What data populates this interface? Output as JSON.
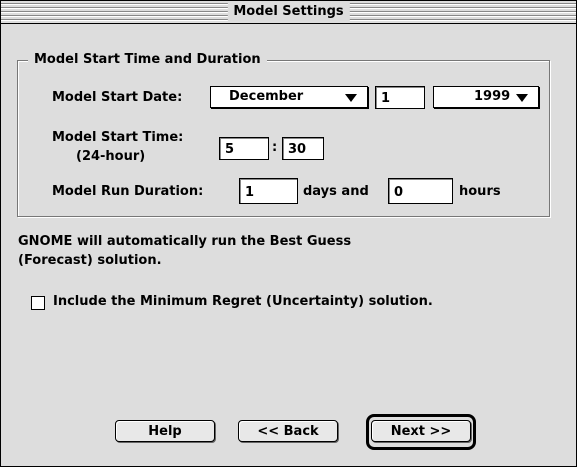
{
  "window": {
    "title": "Model Settings"
  },
  "group": {
    "legend": "Model Start Time and Duration",
    "start_date_label": "Model Start Date:",
    "month": "December",
    "day": "1",
    "year": "1999",
    "start_time_label_line1": "Model Start Time:",
    "start_time_label_line2": "(24-hour)",
    "hour": "5",
    "time_separator": ":",
    "minute": "30",
    "run_duration_label": "Model Run Duration:",
    "days": "1",
    "days_and_label": "days and",
    "hours": "0",
    "hours_label": "hours"
  },
  "info": {
    "line1": "GNOME will automatically run the Best Guess",
    "line2": "(Forecast) solution."
  },
  "option": {
    "min_regret_label": "Include the Minimum Regret (Uncertainty) solution.",
    "min_regret_checked": false
  },
  "buttons": {
    "help": "Help",
    "back": "<< Back",
    "next": "Next >>"
  }
}
